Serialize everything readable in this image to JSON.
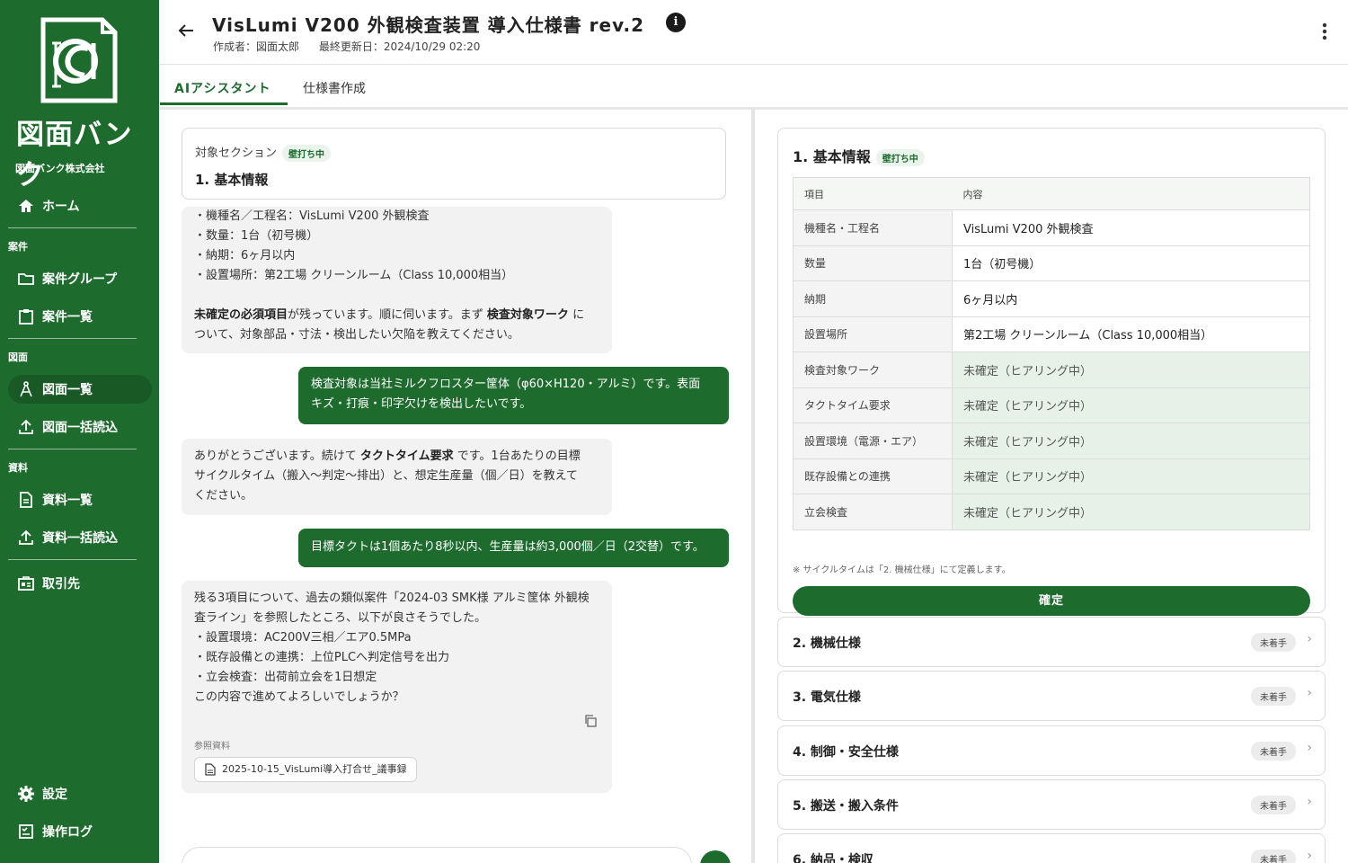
{
  "sidebar": {
    "logo_text": "図面バンク",
    "company": "図面バンク株式会社",
    "home": "ホーム",
    "section_cases": "案件",
    "case_groups": "案件グループ",
    "case_list": "案件一覧",
    "section_drawings": "図面",
    "drawing_list": "図面一覧",
    "drawing_bulk_import": "図面一括読込",
    "section_docs": "資料",
    "doc_list": "資料一覧",
    "doc_bulk_import": "資料一括読込",
    "clients": "取引先",
    "settings": "設定",
    "operation_log": "操作ログ"
  },
  "header": {
    "title": "VisLumi V200 外観検査装置 導入仕様書 rev.2",
    "author": "作成者：図面太郎",
    "updated": "最終更新日：2024/10/29 02:20"
  },
  "tabs": {
    "ai": "AIアシスタント",
    "spec": "仕様書作成"
  },
  "chat": {
    "section_label": "対象セクション",
    "section_badge": "壁打ち中",
    "section_name": "1. 基本情報",
    "msg1": {
      "lines": [
        "・機種名／工程名：VisLumi V200 外観検査",
        "・数量：1台（初号機）",
        "・納期：6ヶ月以内",
        "・設置場所：第2工場 クリーンルーム（Class 10,000相当）"
      ],
      "p_bold1": "未確定の必須項目",
      "p_text1": "が残っています。順に伺います。まず",
      "p_bold2": "検査対象ワーク",
      "p_text2": "に",
      "p_line2": "ついて、対象部品・寸法・検出したい欠陥を教えてください。"
    },
    "user1": {
      "line1": "検査対象は当社ミルクフロスター筐体（φ60×H120・アルミ）です。表面",
      "line2": "キズ・打痕・印字欠けを検出したいです。"
    },
    "msg2": {
      "text1": "ありがとうございます。続けて",
      "bold": "タクトタイム要求",
      "text2": "です。1台あたりの目標",
      "line2": "サイクルタイム（搬入〜判定〜排出）と、想定生産量（個／日）を教えて",
      "line3": "ください。"
    },
    "user2": "目標タクトは1個あたり8秒以内、生産量は約3,000個／日（2交替）です。",
    "msg3": {
      "lines": [
        "残る3項目について、過去の類似案件「2024-03 SMK様 アルミ筐体 外観検",
        "査ライン」を参照したところ、以下が良さそうでした。",
        "・設置環境：AC200V三相／エア0.5MPa",
        "・既存設備との連携：上位PLCへ判定信号を出力",
        "・立会検査：出荷前立会を1日想定",
        "この内容で進めてよろしいでしょうか？"
      ],
      "ref_label": "参照資料",
      "ref_file": "2025-10-15_VisLumi導入打合せ_議事録"
    }
  },
  "spec": {
    "section_title": "1. 基本情報",
    "section_badge": "壁打ち中",
    "table_head": [
      "項目",
      "内容"
    ],
    "rows": [
      {
        "k": "機種名・工程名",
        "v": "VisLumi V200 外観検査"
      },
      {
        "k": "数量",
        "v": "1台（初号機）"
      },
      {
        "k": "納期",
        "v": "6ヶ月以内"
      },
      {
        "k": "設置場所",
        "v": "第2工場 クリーンルーム（Class 10,000相当）"
      },
      {
        "k": "検査対象ワーク",
        "v": "未確定（ヒアリング中）"
      },
      {
        "k": "タクトタイム要求",
        "v": "未確定（ヒアリング中）"
      },
      {
        "k": "設置環境（電源・エア）",
        "v": "未確定（ヒアリング中）"
      },
      {
        "k": "既存設備との連携",
        "v": "未確定（ヒアリング中）"
      },
      {
        "k": "立会検査",
        "v": "未確定（ヒアリング中）"
      }
    ],
    "note": "※ サイクルタイムは「2. 機械仕様」にて定義します。",
    "confirm": "確定",
    "sections": [
      {
        "name": "2. 機械仕様",
        "status": "未着手"
      },
      {
        "name": "3. 電気仕様",
        "status": "未着手"
      },
      {
        "name": "4. 制御・安全仕様",
        "status": "未着手"
      },
      {
        "name": "5. 搬送・搬入条件",
        "status": "未着手"
      },
      {
        "name": "6. 納品・検収",
        "status": "未着手"
      }
    ]
  },
  "colors": {
    "brand": "#1e6b2e",
    "pending_bg": "#e6f2e8"
  }
}
